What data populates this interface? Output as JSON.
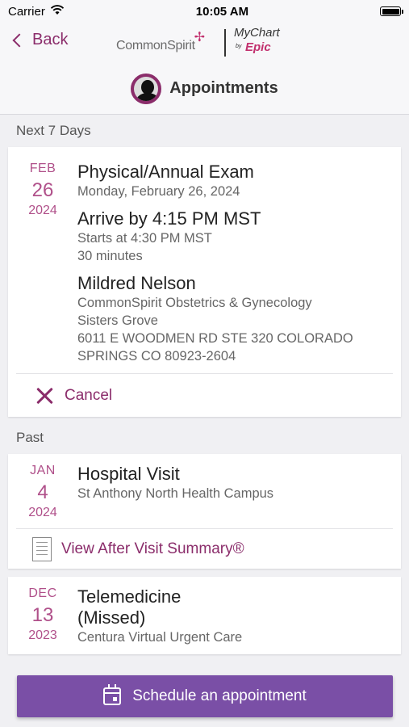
{
  "status": {
    "carrier": "Carrier",
    "time": "10:05 AM"
  },
  "nav": {
    "back_label": "Back",
    "logo_commonspirit": "CommonSpirit",
    "logo_mychart": "MyChart",
    "logo_by": "by",
    "logo_epic": "Epic"
  },
  "header": {
    "title": "Appointments"
  },
  "sections": {
    "next": "Next 7 Days",
    "past": "Past"
  },
  "upcoming": {
    "month": "FEB",
    "day": "26",
    "year": "2024",
    "type": "Physical/Annual Exam",
    "date_text": "Monday, February 26, 2024",
    "arrive": "Arrive by 4:15 PM MST",
    "starts": "Starts at 4:30 PM MST",
    "duration": "30 minutes",
    "provider": "Mildred Nelson",
    "dept": "CommonSpirit Obstetrics & Gynecology",
    "location": "Sisters Grove",
    "address1": "6011 E WOODMEN RD STE 320 COLORADO",
    "address2": "SPRINGS CO 80923-2604",
    "cancel_label": "Cancel"
  },
  "past": [
    {
      "month": "JAN",
      "day": "4",
      "year": "2024",
      "type": "Hospital Visit",
      "location": "St Anthony North Health Campus",
      "action_label": "View After Visit Summary®"
    },
    {
      "month": "DEC",
      "day": "13",
      "year": "2023",
      "type_line1": "Telemedicine",
      "type_line2": "(Missed)",
      "location": "Centura Virtual Urgent Care"
    }
  ],
  "schedule_button": {
    "label": "Schedule an appointment"
  },
  "colors": {
    "accent": "#8b2d6b",
    "date": "#b0508a",
    "button": "#7a4fa6",
    "epic": "#c2306e"
  }
}
